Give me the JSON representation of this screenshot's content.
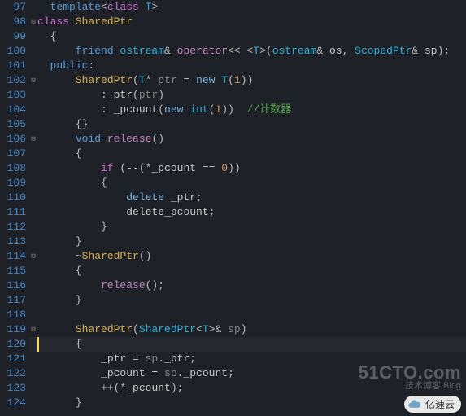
{
  "startLine": 97,
  "lines": [
    {
      "n": 97,
      "fold": " ",
      "tokens": [
        [
          "  ",
          "plain"
        ],
        [
          "template",
          "kw-blue"
        ],
        [
          "<",
          "punct"
        ],
        [
          "class",
          "kw-mag"
        ],
        [
          " T",
          "type"
        ],
        [
          ">",
          "punct"
        ]
      ]
    },
    {
      "n": 98,
      "fold": "⊟",
      "tokens": [
        [
          "class ",
          "kw-mag"
        ],
        [
          "SharedPtr",
          "class-name"
        ]
      ]
    },
    {
      "n": 99,
      "fold": " ",
      "tokens": [
        [
          "  {",
          "punct"
        ]
      ]
    },
    {
      "n": 100,
      "fold": " ",
      "tokens": [
        [
          "      ",
          "plain"
        ],
        [
          "friend ",
          "kw-blue"
        ],
        [
          "ostream",
          "type"
        ],
        [
          "&",
          "op"
        ],
        [
          " ",
          "plain"
        ],
        [
          "operator",
          "func"
        ],
        [
          "<< <",
          "op"
        ],
        [
          "T",
          "type"
        ],
        [
          ">(",
          "punct"
        ],
        [
          "ostream",
          "type"
        ],
        [
          "&",
          "op"
        ],
        [
          " os",
          "plain"
        ],
        [
          ", ",
          "punct"
        ],
        [
          "ScopedPtr",
          "type"
        ],
        [
          "&",
          "op"
        ],
        [
          " sp",
          "plain"
        ],
        [
          ")",
          "punct"
        ],
        [
          ";",
          "punct"
        ]
      ]
    },
    {
      "n": 101,
      "fold": " ",
      "tokens": [
        [
          "  ",
          "plain"
        ],
        [
          "public",
          "kw-blue"
        ],
        [
          ":",
          "punct"
        ]
      ]
    },
    {
      "n": 102,
      "fold": "⊟",
      "tokens": [
        [
          "      ",
          "plain"
        ],
        [
          "SharedPtr",
          "class-name"
        ],
        [
          "(",
          "punct"
        ],
        [
          "T",
          "type"
        ],
        [
          "*",
          "op"
        ],
        [
          " ptr",
          "param"
        ],
        [
          " = ",
          "op"
        ],
        [
          "new ",
          "kw-sky"
        ],
        [
          "T",
          "type"
        ],
        [
          "(",
          "punct"
        ],
        [
          "1",
          "num"
        ],
        [
          ")",
          "punct"
        ],
        [
          ")",
          "punct"
        ]
      ]
    },
    {
      "n": 103,
      "fold": " ",
      "tokens": [
        [
          "          :",
          "punct"
        ],
        [
          "_ptr",
          "plain"
        ],
        [
          "(",
          "punct"
        ],
        [
          "ptr",
          "param"
        ],
        [
          ")",
          "punct"
        ]
      ]
    },
    {
      "n": 104,
      "fold": " ",
      "tokens": [
        [
          "          : ",
          "punct"
        ],
        [
          "_pcount",
          "plain"
        ],
        [
          "(",
          "punct"
        ],
        [
          "new ",
          "kw-sky"
        ],
        [
          "int",
          "type"
        ],
        [
          "(",
          "punct"
        ],
        [
          "1",
          "num"
        ],
        [
          ")",
          "punct"
        ],
        [
          ")  ",
          "punct"
        ],
        [
          "//计数器",
          "comment"
        ]
      ]
    },
    {
      "n": 105,
      "fold": " ",
      "tokens": [
        [
          "      {}",
          "punct"
        ]
      ]
    },
    {
      "n": 106,
      "fold": "⊟",
      "tokens": [
        [
          "      ",
          "plain"
        ],
        [
          "void",
          "kw-blue"
        ],
        [
          " ",
          "plain"
        ],
        [
          "release",
          "func"
        ],
        [
          "()",
          "punct"
        ]
      ]
    },
    {
      "n": 107,
      "fold": " ",
      "tokens": [
        [
          "      {",
          "punct"
        ]
      ]
    },
    {
      "n": 108,
      "fold": " ",
      "tokens": [
        [
          "          ",
          "plain"
        ],
        [
          "if",
          "kw-mag"
        ],
        [
          " (",
          "punct"
        ],
        [
          "--",
          "op"
        ],
        [
          "(",
          "punct"
        ],
        [
          "*",
          "op"
        ],
        [
          "_pcount",
          "plain"
        ],
        [
          " == ",
          "op"
        ],
        [
          "0",
          "num"
        ],
        [
          ")",
          "punct"
        ],
        [
          ")",
          "punct"
        ]
      ]
    },
    {
      "n": 109,
      "fold": " ",
      "tokens": [
        [
          "          {",
          "punct"
        ]
      ]
    },
    {
      "n": 110,
      "fold": " ",
      "tokens": [
        [
          "              ",
          "plain"
        ],
        [
          "delete",
          "kw-sky"
        ],
        [
          " _ptr",
          "plain"
        ],
        [
          ";",
          "punct"
        ]
      ]
    },
    {
      "n": 111,
      "fold": " ",
      "tokens": [
        [
          "              delete_pcount",
          "plain"
        ],
        [
          ";",
          "punct"
        ]
      ]
    },
    {
      "n": 112,
      "fold": " ",
      "tokens": [
        [
          "          }",
          "punct"
        ]
      ]
    },
    {
      "n": 113,
      "fold": " ",
      "tokens": [
        [
          "      }",
          "punct"
        ]
      ]
    },
    {
      "n": 114,
      "fold": "⊟",
      "tokens": [
        [
          "      ~",
          "op"
        ],
        [
          "SharedPtr",
          "class-name"
        ],
        [
          "()",
          "punct"
        ]
      ]
    },
    {
      "n": 115,
      "fold": " ",
      "tokens": [
        [
          "      {",
          "punct"
        ]
      ]
    },
    {
      "n": 116,
      "fold": " ",
      "tokens": [
        [
          "          ",
          "plain"
        ],
        [
          "release",
          "func"
        ],
        [
          "()",
          "punct"
        ],
        [
          ";",
          "punct"
        ]
      ]
    },
    {
      "n": 117,
      "fold": " ",
      "tokens": [
        [
          "      }",
          "punct"
        ]
      ]
    },
    {
      "n": 118,
      "fold": " ",
      "tokens": [
        [
          "",
          "plain"
        ]
      ]
    },
    {
      "n": 119,
      "fold": "⊟",
      "tokens": [
        [
          "      ",
          "plain"
        ],
        [
          "SharedPtr",
          "class-name"
        ],
        [
          "(",
          "punct"
        ],
        [
          "SharedPtr",
          "type"
        ],
        [
          "<",
          "punct"
        ],
        [
          "T",
          "type"
        ],
        [
          ">",
          "punct"
        ],
        [
          "&",
          "op"
        ],
        [
          " sp",
          "param"
        ],
        [
          ")",
          "punct"
        ]
      ]
    },
    {
      "n": 120,
      "fold": " ",
      "cursor": true,
      "tokens": [
        [
          "      {",
          "punct"
        ]
      ]
    },
    {
      "n": 121,
      "fold": " ",
      "tokens": [
        [
          "          _ptr = ",
          "plain"
        ],
        [
          "sp",
          "param"
        ],
        [
          "._ptr",
          "plain"
        ],
        [
          ";",
          "punct"
        ]
      ]
    },
    {
      "n": 122,
      "fold": " ",
      "tokens": [
        [
          "          _pcount = ",
          "plain"
        ],
        [
          "sp",
          "param"
        ],
        [
          "._pcount",
          "plain"
        ],
        [
          ";",
          "punct"
        ]
      ]
    },
    {
      "n": 123,
      "fold": " ",
      "tokens": [
        [
          "          ++",
          "op"
        ],
        [
          "(",
          "punct"
        ],
        [
          "*",
          "op"
        ],
        [
          "_pcount",
          "plain"
        ],
        [
          ")",
          "punct"
        ],
        [
          ";",
          "punct"
        ]
      ]
    },
    {
      "n": 124,
      "fold": " ",
      "tokens": [
        [
          "      }",
          "punct"
        ]
      ]
    }
  ],
  "watermark": {
    "big": "51CTO.com",
    "small": "技术博客   Blog"
  },
  "bubble": {
    "label": "亿速云"
  }
}
